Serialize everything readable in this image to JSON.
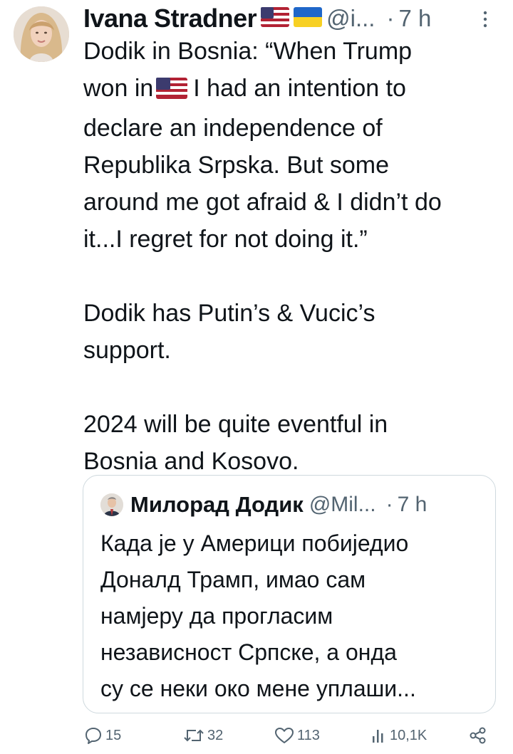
{
  "tweet": {
    "author_name": "Ivana Stradner",
    "handle": "@i...",
    "separator": "·",
    "time": "7 h",
    "lines": [
      "Dodik in Bosnia: “When Trump",
      "won in",
      "I had an intention to",
      "declare an independence of",
      "Republika Srpska. But some",
      "around me got afraid & I didn’t do",
      "it...I regret for not doing it.”",
      "Dodik has Putin’s & Vucic’s",
      "support.",
      "2024 will be quite eventful in",
      "Bosnia and Kosovo."
    ]
  },
  "quote": {
    "author_name": "Милорад Додик",
    "handle": "@Mil...",
    "separator": "·",
    "time": "7 h",
    "lines": [
      "Када је у Америци побиједио",
      "Доналд Трамп, имао сам",
      "намјеру да прогласим",
      "независност Српске, а онда",
      "су се неки око мене уплаши..."
    ]
  },
  "actions": {
    "replies": "15",
    "reposts": "32",
    "likes": "113",
    "views": "10,1K"
  },
  "colors": {
    "text": "#0f1419",
    "secondary": "#536471",
    "border": "#cfd9de"
  }
}
